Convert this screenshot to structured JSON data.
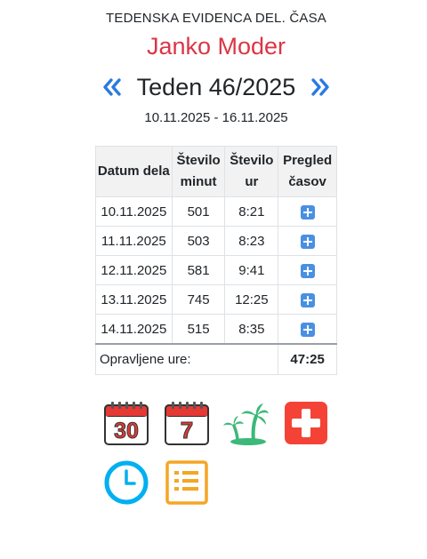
{
  "header": {
    "subtitle": "TEDENSKA EVIDENCA DEL. ČASA",
    "name": "Janko Moder",
    "week_title": "Teden 46/2025",
    "range": "10.11.2025 - 16.11.2025",
    "prev_icon": "double-chevron-left-icon",
    "next_icon": "double-chevron-right-icon"
  },
  "table": {
    "headers": [
      "Datum dela",
      "Število minut",
      "Število ur",
      "Pregled časov"
    ],
    "rows": [
      {
        "date": "10.11.2025",
        "minutes": "501",
        "hours": "8:21"
      },
      {
        "date": "11.11.2025",
        "minutes": "503",
        "hours": "8:23"
      },
      {
        "date": "12.11.2025",
        "minutes": "581",
        "hours": "9:41"
      },
      {
        "date": "13.11.2025",
        "minutes": "745",
        "hours": "12:25"
      },
      {
        "date": "14.11.2025",
        "minutes": "515",
        "hours": "8:35"
      }
    ],
    "footer_label": "Opravljene ure:",
    "footer_total": "47:25"
  },
  "icons": {
    "month_calendar": {
      "name": "month-calendar-icon",
      "text": "30"
    },
    "week_calendar": {
      "name": "week-calendar-icon",
      "text": "7"
    },
    "vacation": "palm-trees-icon",
    "sick_leave": "medical-cross-icon",
    "clock": "clock-icon",
    "list": "list-icon"
  },
  "colors": {
    "name": "#dc3545",
    "arrow": "#2a7ae2",
    "plus": "#4a90e2",
    "calendar_red": "#e53935",
    "palm_green": "#3cb878",
    "cross_red": "#f44336",
    "clock_blue": "#00b0f0",
    "list_orange": "#f5a623"
  }
}
